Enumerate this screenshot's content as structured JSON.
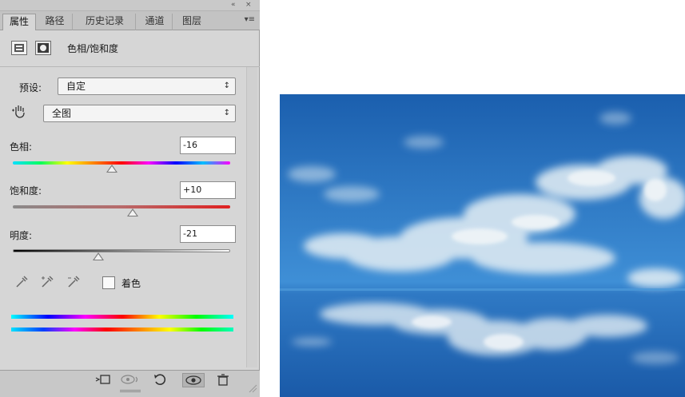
{
  "panel": {
    "topbar": {
      "collapse": "«",
      "close": "×"
    },
    "tabs": [
      {
        "label": "属性",
        "active": true
      },
      {
        "label": "路径",
        "active": false
      },
      {
        "label": "历史记录",
        "active": false
      },
      {
        "label": "通道",
        "active": false
      },
      {
        "label": "图层",
        "active": false
      }
    ],
    "menu_icon": "▾≡",
    "header": {
      "title": "色相/饱和度"
    },
    "preset": {
      "label": "预设:",
      "value": "自定"
    },
    "channel": {
      "value": "全图"
    },
    "hue": {
      "label": "色相:",
      "value": "-16",
      "level": -16,
      "range": [
        -180,
        180
      ]
    },
    "saturation": {
      "label": "饱和度:",
      "value": "+10",
      "level": 10,
      "range": [
        -100,
        100
      ]
    },
    "lightness": {
      "label": "明度:",
      "value": "-21",
      "level": -21,
      "range": [
        -100,
        100
      ]
    },
    "colorize": {
      "label": "着色",
      "checked": false
    },
    "select_arrow": "↕",
    "bottom_icons": [
      "clip-to-layer-icon",
      "view-previous-icon",
      "reset-icon",
      "visibility-icon",
      "delete-icon"
    ]
  },
  "colors": {
    "panel_bg": "#d6d6d6",
    "sky_top": "#1b5fae",
    "sky_horizon": "#3f8fd6"
  }
}
